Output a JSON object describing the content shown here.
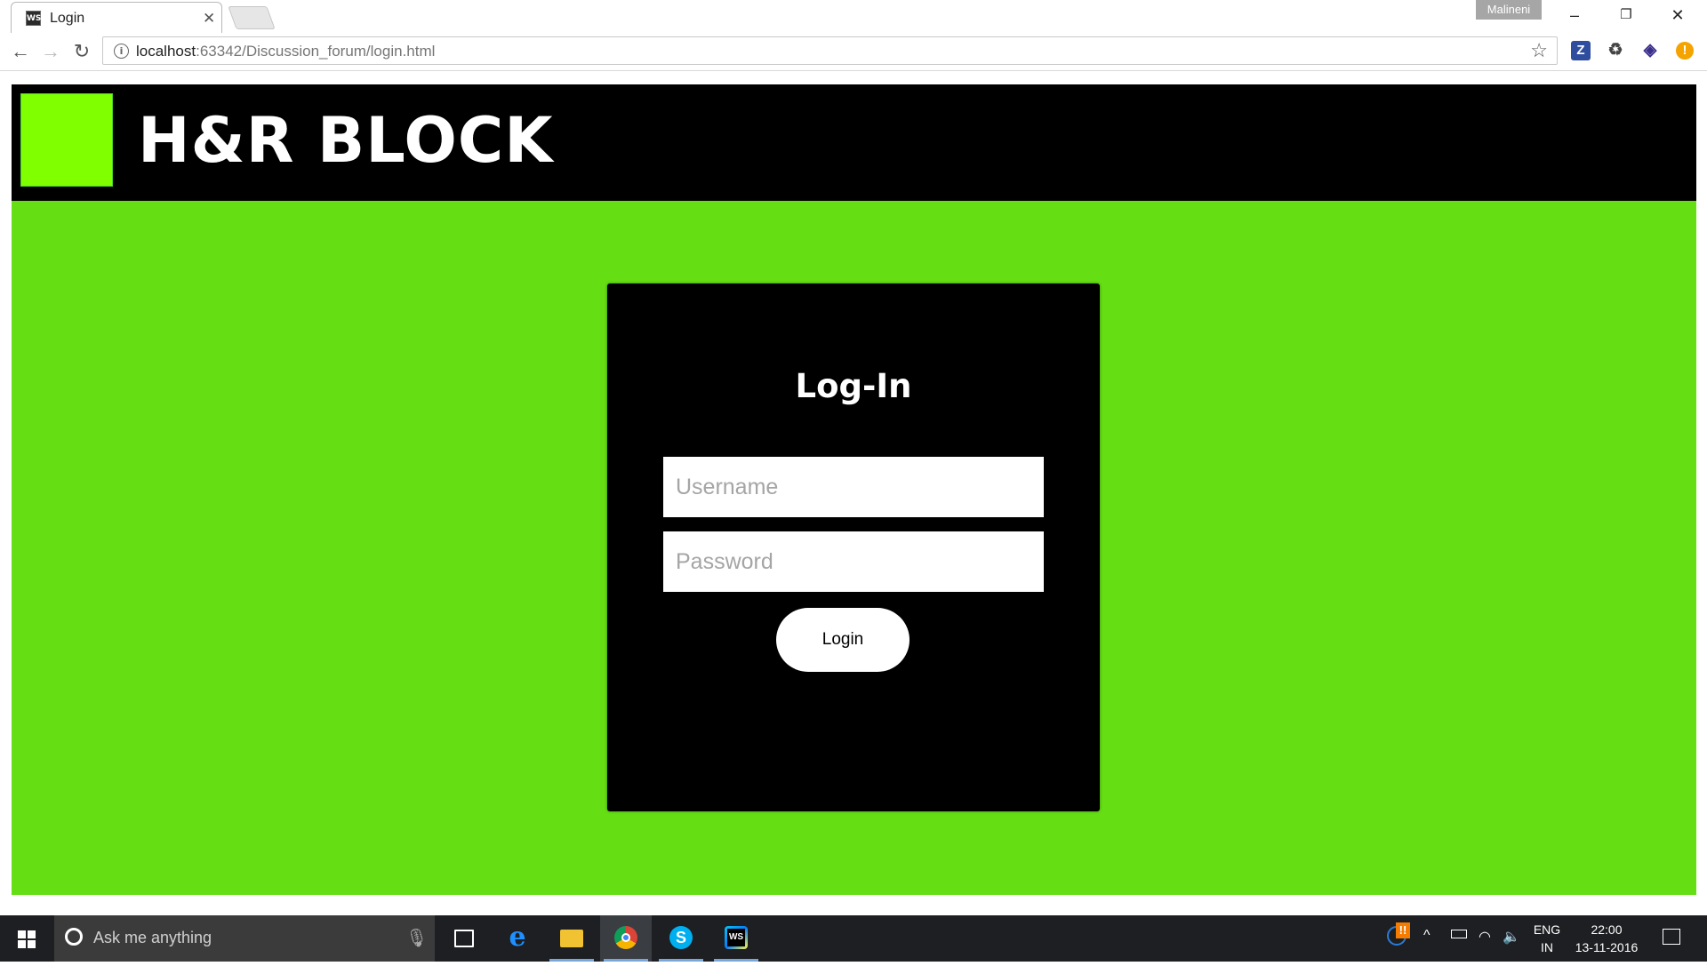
{
  "browser": {
    "tab_title": "Login",
    "tab_favicon": "WS",
    "profile_name": "Malineni",
    "url_host": "localhost",
    "url_rest": ":63342/Discussion_forum/login.html",
    "extensions": [
      {
        "name": "zotero-icon",
        "glyph": "Z",
        "color": "#2f4d9e"
      },
      {
        "name": "recycle-icon",
        "glyph": "♻",
        "color": "#444444"
      },
      {
        "name": "extension-icon",
        "glyph": "◈",
        "color": "#3a2f8a"
      },
      {
        "name": "alert-icon",
        "glyph": "!",
        "color": "#f4a300"
      }
    ]
  },
  "page": {
    "brand": "H&R BLOCK",
    "colors": {
      "background": "#65df14",
      "logo": "#7fff00",
      "header": "#000000"
    },
    "login": {
      "title": "Log-In",
      "username_placeholder": "Username",
      "password_placeholder": "Password",
      "button_label": "Login"
    }
  },
  "taskbar": {
    "search_placeholder": "Ask me anything",
    "language_line1": "ENG",
    "language_line2": "IN",
    "time": "22:00",
    "date": "13-11-2016"
  }
}
